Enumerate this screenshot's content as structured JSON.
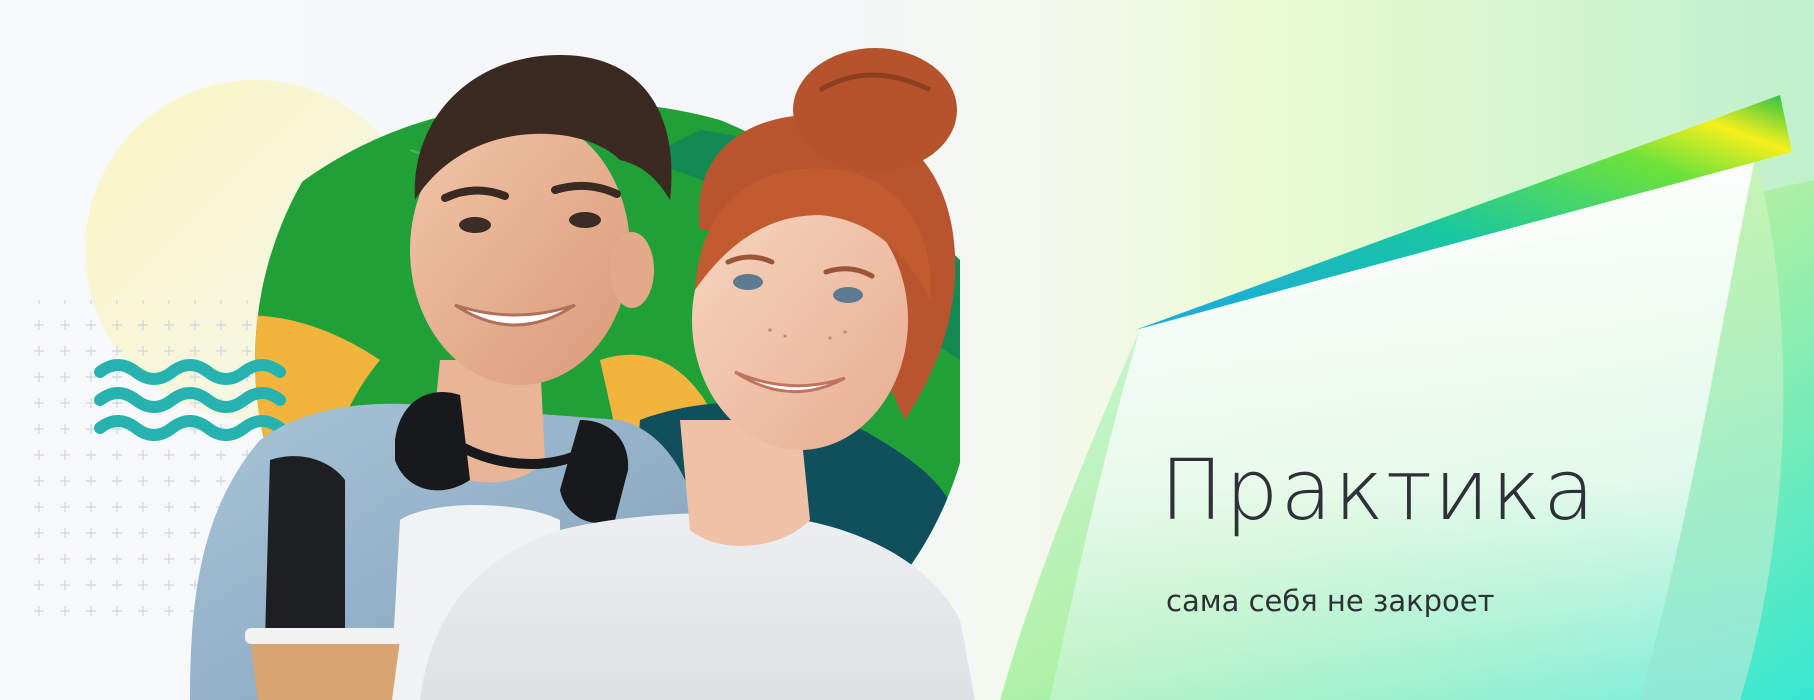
{
  "banner": {
    "headline": "Практика",
    "subheadline": "сама себя не закроет"
  },
  "colors": {
    "text": "#2e3136",
    "brand_green": "#21a038",
    "teal_wave": "#26b3b0",
    "dark_teal": "#10505c",
    "orange": "#f2b43c"
  },
  "icons": [
    "wave-lines-icon",
    "plus-grid-pattern"
  ],
  "image": {
    "description_alt": "students-photo"
  }
}
